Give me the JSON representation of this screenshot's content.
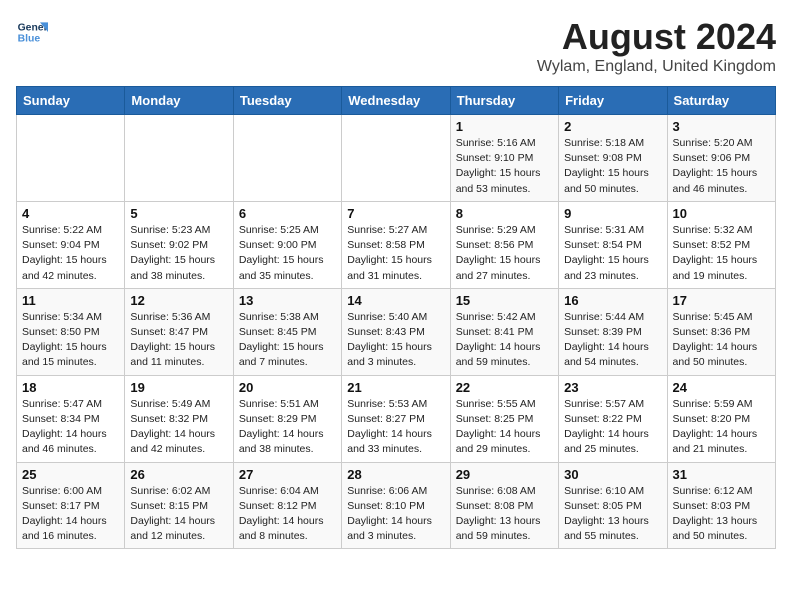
{
  "header": {
    "logo_line1": "General",
    "logo_line2": "Blue",
    "title": "August 2024",
    "subtitle": "Wylam, England, United Kingdom"
  },
  "weekdays": [
    "Sunday",
    "Monday",
    "Tuesday",
    "Wednesday",
    "Thursday",
    "Friday",
    "Saturday"
  ],
  "weeks": [
    [
      {
        "day": "",
        "info": ""
      },
      {
        "day": "",
        "info": ""
      },
      {
        "day": "",
        "info": ""
      },
      {
        "day": "",
        "info": ""
      },
      {
        "day": "1",
        "info": "Sunrise: 5:16 AM\nSunset: 9:10 PM\nDaylight: 15 hours\nand 53 minutes."
      },
      {
        "day": "2",
        "info": "Sunrise: 5:18 AM\nSunset: 9:08 PM\nDaylight: 15 hours\nand 50 minutes."
      },
      {
        "day": "3",
        "info": "Sunrise: 5:20 AM\nSunset: 9:06 PM\nDaylight: 15 hours\nand 46 minutes."
      }
    ],
    [
      {
        "day": "4",
        "info": "Sunrise: 5:22 AM\nSunset: 9:04 PM\nDaylight: 15 hours\nand 42 minutes."
      },
      {
        "day": "5",
        "info": "Sunrise: 5:23 AM\nSunset: 9:02 PM\nDaylight: 15 hours\nand 38 minutes."
      },
      {
        "day": "6",
        "info": "Sunrise: 5:25 AM\nSunset: 9:00 PM\nDaylight: 15 hours\nand 35 minutes."
      },
      {
        "day": "7",
        "info": "Sunrise: 5:27 AM\nSunset: 8:58 PM\nDaylight: 15 hours\nand 31 minutes."
      },
      {
        "day": "8",
        "info": "Sunrise: 5:29 AM\nSunset: 8:56 PM\nDaylight: 15 hours\nand 27 minutes."
      },
      {
        "day": "9",
        "info": "Sunrise: 5:31 AM\nSunset: 8:54 PM\nDaylight: 15 hours\nand 23 minutes."
      },
      {
        "day": "10",
        "info": "Sunrise: 5:32 AM\nSunset: 8:52 PM\nDaylight: 15 hours\nand 19 minutes."
      }
    ],
    [
      {
        "day": "11",
        "info": "Sunrise: 5:34 AM\nSunset: 8:50 PM\nDaylight: 15 hours\nand 15 minutes."
      },
      {
        "day": "12",
        "info": "Sunrise: 5:36 AM\nSunset: 8:47 PM\nDaylight: 15 hours\nand 11 minutes."
      },
      {
        "day": "13",
        "info": "Sunrise: 5:38 AM\nSunset: 8:45 PM\nDaylight: 15 hours\nand 7 minutes."
      },
      {
        "day": "14",
        "info": "Sunrise: 5:40 AM\nSunset: 8:43 PM\nDaylight: 15 hours\nand 3 minutes."
      },
      {
        "day": "15",
        "info": "Sunrise: 5:42 AM\nSunset: 8:41 PM\nDaylight: 14 hours\nand 59 minutes."
      },
      {
        "day": "16",
        "info": "Sunrise: 5:44 AM\nSunset: 8:39 PM\nDaylight: 14 hours\nand 54 minutes."
      },
      {
        "day": "17",
        "info": "Sunrise: 5:45 AM\nSunset: 8:36 PM\nDaylight: 14 hours\nand 50 minutes."
      }
    ],
    [
      {
        "day": "18",
        "info": "Sunrise: 5:47 AM\nSunset: 8:34 PM\nDaylight: 14 hours\nand 46 minutes."
      },
      {
        "day": "19",
        "info": "Sunrise: 5:49 AM\nSunset: 8:32 PM\nDaylight: 14 hours\nand 42 minutes."
      },
      {
        "day": "20",
        "info": "Sunrise: 5:51 AM\nSunset: 8:29 PM\nDaylight: 14 hours\nand 38 minutes."
      },
      {
        "day": "21",
        "info": "Sunrise: 5:53 AM\nSunset: 8:27 PM\nDaylight: 14 hours\nand 33 minutes."
      },
      {
        "day": "22",
        "info": "Sunrise: 5:55 AM\nSunset: 8:25 PM\nDaylight: 14 hours\nand 29 minutes."
      },
      {
        "day": "23",
        "info": "Sunrise: 5:57 AM\nSunset: 8:22 PM\nDaylight: 14 hours\nand 25 minutes."
      },
      {
        "day": "24",
        "info": "Sunrise: 5:59 AM\nSunset: 8:20 PM\nDaylight: 14 hours\nand 21 minutes."
      }
    ],
    [
      {
        "day": "25",
        "info": "Sunrise: 6:00 AM\nSunset: 8:17 PM\nDaylight: 14 hours\nand 16 minutes."
      },
      {
        "day": "26",
        "info": "Sunrise: 6:02 AM\nSunset: 8:15 PM\nDaylight: 14 hours\nand 12 minutes."
      },
      {
        "day": "27",
        "info": "Sunrise: 6:04 AM\nSunset: 8:12 PM\nDaylight: 14 hours\nand 8 minutes."
      },
      {
        "day": "28",
        "info": "Sunrise: 6:06 AM\nSunset: 8:10 PM\nDaylight: 14 hours\nand 3 minutes."
      },
      {
        "day": "29",
        "info": "Sunrise: 6:08 AM\nSunset: 8:08 PM\nDaylight: 13 hours\nand 59 minutes."
      },
      {
        "day": "30",
        "info": "Sunrise: 6:10 AM\nSunset: 8:05 PM\nDaylight: 13 hours\nand 55 minutes."
      },
      {
        "day": "31",
        "info": "Sunrise: 6:12 AM\nSunset: 8:03 PM\nDaylight: 13 hours\nand 50 minutes."
      }
    ]
  ]
}
